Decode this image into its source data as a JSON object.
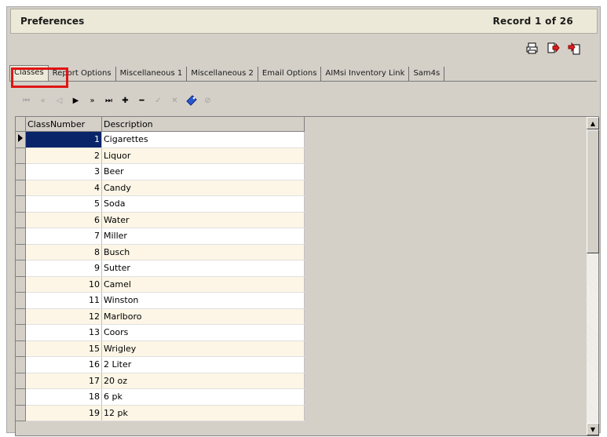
{
  "window": {
    "title": "Preferences",
    "record": "Record  1  of  26"
  },
  "toolbar": {
    "icons": [
      "printer-icon",
      "export-icon",
      "import-icon"
    ]
  },
  "tabs": [
    {
      "label": "Classes",
      "active": true
    },
    {
      "label": "Report Options"
    },
    {
      "label": "Miscellaneous 1"
    },
    {
      "label": "Miscellaneous 2"
    },
    {
      "label": "Email Options"
    },
    {
      "label": "AIMsi Inventory Link"
    },
    {
      "label": "Sam4s"
    }
  ],
  "navigator": {
    "buttons": [
      {
        "name": "first-record",
        "glyph": "⏮",
        "enabled": false
      },
      {
        "name": "prior-page",
        "glyph": "«",
        "enabled": false
      },
      {
        "name": "prior-record",
        "glyph": "◁",
        "enabled": false
      },
      {
        "name": "next-record",
        "glyph": "▶",
        "enabled": true
      },
      {
        "name": "next-page",
        "glyph": "»",
        "enabled": true
      },
      {
        "name": "last-record",
        "glyph": "⏭",
        "enabled": true
      },
      {
        "name": "insert-record",
        "glyph": "✚",
        "enabled": true
      },
      {
        "name": "delete-record",
        "glyph": "━",
        "enabled": true
      },
      {
        "name": "post-edit",
        "glyph": "✓",
        "enabled": false
      },
      {
        "name": "cancel-edit",
        "glyph": "✕",
        "enabled": false
      },
      {
        "name": "refresh-data",
        "glyph": "◆",
        "enabled": true
      },
      {
        "name": "goto-record",
        "glyph": "⊘",
        "enabled": false
      }
    ]
  },
  "grid": {
    "columns": [
      "ClassNumber",
      "Description"
    ],
    "rows": [
      {
        "num": "1",
        "desc": "Cigarettes"
      },
      {
        "num": "2",
        "desc": "Liquor"
      },
      {
        "num": "3",
        "desc": "Beer"
      },
      {
        "num": "4",
        "desc": "Candy"
      },
      {
        "num": "5",
        "desc": "Soda"
      },
      {
        "num": "6",
        "desc": "Water"
      },
      {
        "num": "7",
        "desc": "Miller"
      },
      {
        "num": "8",
        "desc": "Busch"
      },
      {
        "num": "9",
        "desc": "Sutter"
      },
      {
        "num": "10",
        "desc": "Camel"
      },
      {
        "num": "11",
        "desc": "Winston"
      },
      {
        "num": "12",
        "desc": "Marlboro"
      },
      {
        "num": "13",
        "desc": "Coors"
      },
      {
        "num": "15",
        "desc": "Wrigley"
      },
      {
        "num": "16",
        "desc": "2 Liter"
      },
      {
        "num": "17",
        "desc": "20 oz"
      },
      {
        "num": "18",
        "desc": "6 pk"
      },
      {
        "num": "19",
        "desc": "12 pk"
      }
    ]
  },
  "colors": {
    "highlight": "#e01414",
    "selection": "#0a246a",
    "row_alt": "#fdf6e6"
  }
}
